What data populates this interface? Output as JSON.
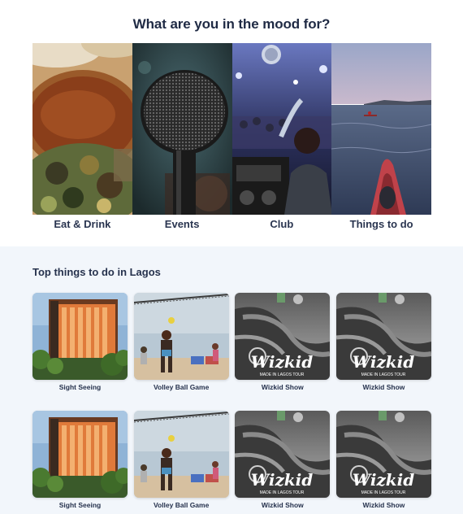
{
  "mood": {
    "title": "What are you in the mood for?",
    "cards": [
      {
        "label": "Eat & Drink"
      },
      {
        "label": "Events"
      },
      {
        "label": "Club"
      },
      {
        "label": "Things to do"
      }
    ]
  },
  "top_things": {
    "title": "Top things to do in Lagos",
    "rows": [
      [
        {
          "label": "Sight Seeing",
          "kind": "sight"
        },
        {
          "label": "Volley Ball Game",
          "kind": "volley"
        },
        {
          "label": "Wizkid Show",
          "kind": "wizkid"
        },
        {
          "label": "Wizkid Show",
          "kind": "wizkid"
        }
      ],
      [
        {
          "label": "Sight Seeing",
          "kind": "sight"
        },
        {
          "label": "Volley Ball Game",
          "kind": "volley"
        },
        {
          "label": "Wizkid Show",
          "kind": "wizkid"
        },
        {
          "label": "Wizkid Show",
          "kind": "wizkid"
        }
      ]
    ],
    "poster": {
      "brand": "Wizkid",
      "tagline": "MADE IN LAGOS TOUR"
    }
  }
}
